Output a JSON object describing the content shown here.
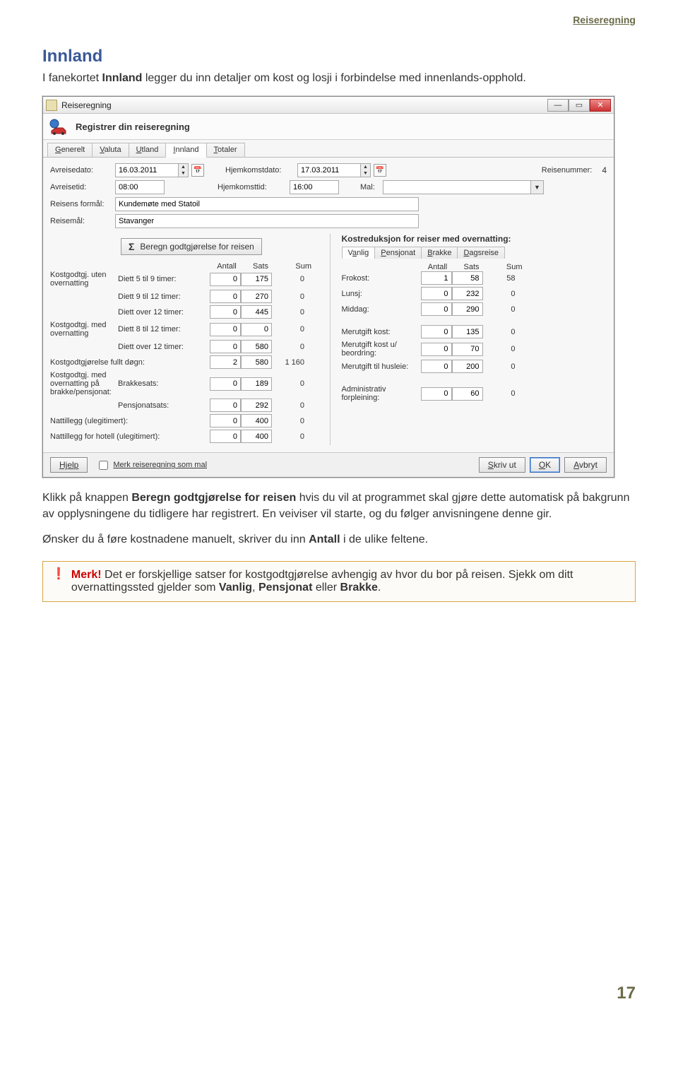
{
  "header_link": "Reiseregning",
  "section_title": "Innland",
  "intro": {
    "p1_a": "I fanekortet ",
    "p1_b": "Innland",
    "p1_c": " legger du inn detaljer om kost og losji i forbindelse med innenlands-opphold."
  },
  "window": {
    "title": "Reiseregning",
    "subtitle": "Registrer din reiseregning",
    "tabs": [
      "Generelt",
      "Valuta",
      "Utland",
      "Innland",
      "Totaler"
    ],
    "active_tab_index": 3,
    "labels": {
      "avreisedato": "Avreisedato:",
      "hjemkomstdato": "Hjemkomstdato:",
      "reisenummer": "Reisenummer:",
      "avreisetid": "Avreisetid:",
      "hjemkomsttid": "Hjemkomsttid:",
      "mal": "Mal:",
      "reisens_formal": "Reisens formål:",
      "reisemal": "Reisemål:",
      "beregn_btn": "Beregn godtgjørelse for reisen",
      "antall": "Antall",
      "sats": "Sats",
      "sum": "Sum",
      "kost_uten": "Kostgodtgj. uten overnatting",
      "diett_5_9": "Diett 5 til 9 timer:",
      "diett_9_12": "Diett 9 til 12 timer:",
      "diett_over12_a": "Diett over 12 timer:",
      "kost_med": "Kostgodtgj. med overnatting",
      "diett_8_12": "Diett 8 til 12 timer:",
      "diett_over12_b": "Diett over 12 timer:",
      "kost_full_dogn": "Kostgodtgjørelse fullt døgn:",
      "kost_brakke": "Kostgodtgj. med overnatting på brakke/pensjonat:",
      "brakkesats": "Brakkesats:",
      "pensjonatsats": "Pensjonatsats:",
      "nattillegg": "Nattillegg (ulegitimert):",
      "nattillegg_hotell": "Nattillegg for hotell (ulegitimert):",
      "kostreduksjon": "Kostreduksjon for reiser med overnatting:",
      "ktabs": [
        "Vanlig",
        "Pensjonat",
        "Brakke",
        "Dagsreise"
      ],
      "frokost": "Frokost:",
      "lunsj": "Lunsj:",
      "middag": "Middag:",
      "merutgift_kost": "Merutgift kost:",
      "merutgift_kost_ub": "Merutgift kost u/ beordring:",
      "merutgift_husleie": "Merutgift til husleie:",
      "admin_forpleining": "Administrativ forpleining:",
      "hjelp": "Hjelp",
      "merk_mal": "Merk reiseregning som mal",
      "skriv_ut": "Skriv ut",
      "ok": "OK",
      "avbryt": "Avbryt"
    },
    "values": {
      "avreisedato": "16.03.2011",
      "hjemkomstdato": "17.03.2011",
      "reisenummer": "4",
      "avreisetid": "08:00",
      "hjemkomsttid": "16:00",
      "reisens_formal": "Kundemøte med Statoil",
      "reisemal": "Stavanger",
      "rows_left": [
        {
          "antall": "0",
          "sats": "175",
          "sum": "0"
        },
        {
          "antall": "0",
          "sats": "270",
          "sum": "0"
        },
        {
          "antall": "0",
          "sats": "445",
          "sum": "0"
        },
        {
          "antall": "0",
          "sats": "0",
          "sum": "0"
        },
        {
          "antall": "0",
          "sats": "580",
          "sum": "0"
        },
        {
          "antall": "2",
          "sats": "580",
          "sum": "1 160"
        },
        {
          "antall": "0",
          "sats": "189",
          "sum": "0"
        },
        {
          "antall": "0",
          "sats": "292",
          "sum": "0"
        },
        {
          "antall": "0",
          "sats": "400",
          "sum": "0"
        },
        {
          "antall": "0",
          "sats": "400",
          "sum": "0"
        }
      ],
      "rows_right_meals": [
        {
          "antall": "1",
          "sats": "58",
          "sum": "58"
        },
        {
          "antall": "0",
          "sats": "232",
          "sum": "0"
        },
        {
          "antall": "0",
          "sats": "290",
          "sum": "0"
        }
      ],
      "rows_right_mer": [
        {
          "antall": "0",
          "sats": "135",
          "sum": "0"
        },
        {
          "antall": "0",
          "sats": "70",
          "sum": "0"
        },
        {
          "antall": "0",
          "sats": "200",
          "sum": "0"
        }
      ],
      "rows_right_admin": {
        "antall": "0",
        "sats": "60",
        "sum": "0"
      }
    }
  },
  "para2": {
    "a": "Klikk på knappen ",
    "b": "Beregn godtgjørelse for reisen",
    "c": " hvis du vil at programmet skal gjøre dette automatisk på bakgrunn av opplysningene du tidligere har registrert. En veiviser vil starte, og du følger anvisningene denne gir.",
    "d": "Ønsker du å føre kostnadene manuelt, skriver du inn ",
    "e": "Antall",
    "f": " i de ulike feltene."
  },
  "note": {
    "merk": "Merk!",
    "rest": " Det er forskjellige satser for kostgodtgjørelse avhengig av hvor du bor på reisen. Sjekk om ditt overnattingssted gjelder som ",
    "v": "Vanlig",
    "p": "Pensjonat",
    "b": "Brakke",
    "eller": " eller ",
    "comma": ", "
  },
  "page_number": "17"
}
